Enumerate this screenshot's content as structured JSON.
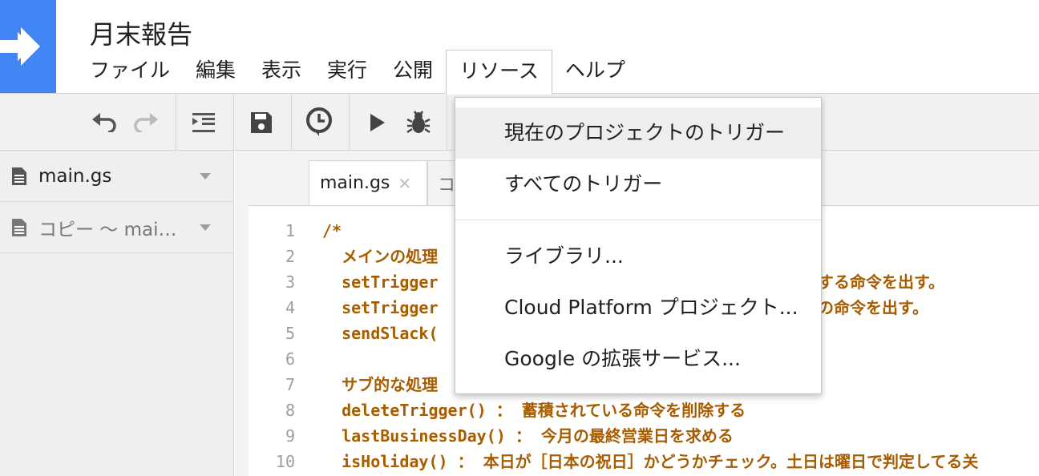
{
  "header": {
    "logo_icon": "arrow-right-icon",
    "brand_color": "#4285f4",
    "title": "月末報告"
  },
  "menu": [
    {
      "label": "ファイル"
    },
    {
      "label": "編集"
    },
    {
      "label": "表示"
    },
    {
      "label": "実行"
    },
    {
      "label": "公開"
    },
    {
      "label": "リソース"
    },
    {
      "label": "ヘルプ"
    }
  ],
  "toolbar": {
    "icons": [
      "undo-icon",
      "redo-icon",
      "indent-icon",
      "save-icon",
      "trigger-clock-icon",
      "run-icon",
      "debug-bug-icon"
    ]
  },
  "sidebar": {
    "files": [
      {
        "name": "main.gs",
        "icon": "document-icon"
      },
      {
        "name": "コピー 〜 mai…",
        "icon": "document-icon"
      }
    ]
  },
  "tabs": {
    "main": {
      "label": "main.gs",
      "close": "✕"
    },
    "copy": {
      "label": "コ"
    }
  },
  "code": {
    "lines": [
      {
        "num": "1",
        "text": "/*"
      },
      {
        "num": "2",
        "text": "  メインの処理"
      },
      {
        "num": "3",
        "text": "  setTrigger"
      },
      {
        "num": "4",
        "text": "  setTrigger"
      },
      {
        "num": "5",
        "text": "  sendSlack("
      },
      {
        "num": "6",
        "text": ""
      },
      {
        "num": "7",
        "text": "  サブ的な処理"
      },
      {
        "num": "8",
        "text": "  deleteTrigger() ： 蓄積されている命令を削除する"
      },
      {
        "num": "9",
        "text": "  lastBusinessDay() ： 今月の最終営業日を求める"
      },
      {
        "num": "10",
        "text": "  isHoliday() ： 本日が［日本の祝日］かどうかチェック。土日は曜日で判定してる关"
      }
    ],
    "overflow_line3": "する命令を出す。",
    "overflow_line4": "の命令を出す。"
  },
  "dropdown": {
    "items": [
      {
        "label": "現在のプロジェクトのトリガー"
      },
      {
        "label": "すべてのトリガー"
      },
      {
        "label": "ライブラリ..."
      },
      {
        "label": "Cloud Platform プロジェクト..."
      },
      {
        "label": "Google の拡張サービス..."
      }
    ]
  }
}
